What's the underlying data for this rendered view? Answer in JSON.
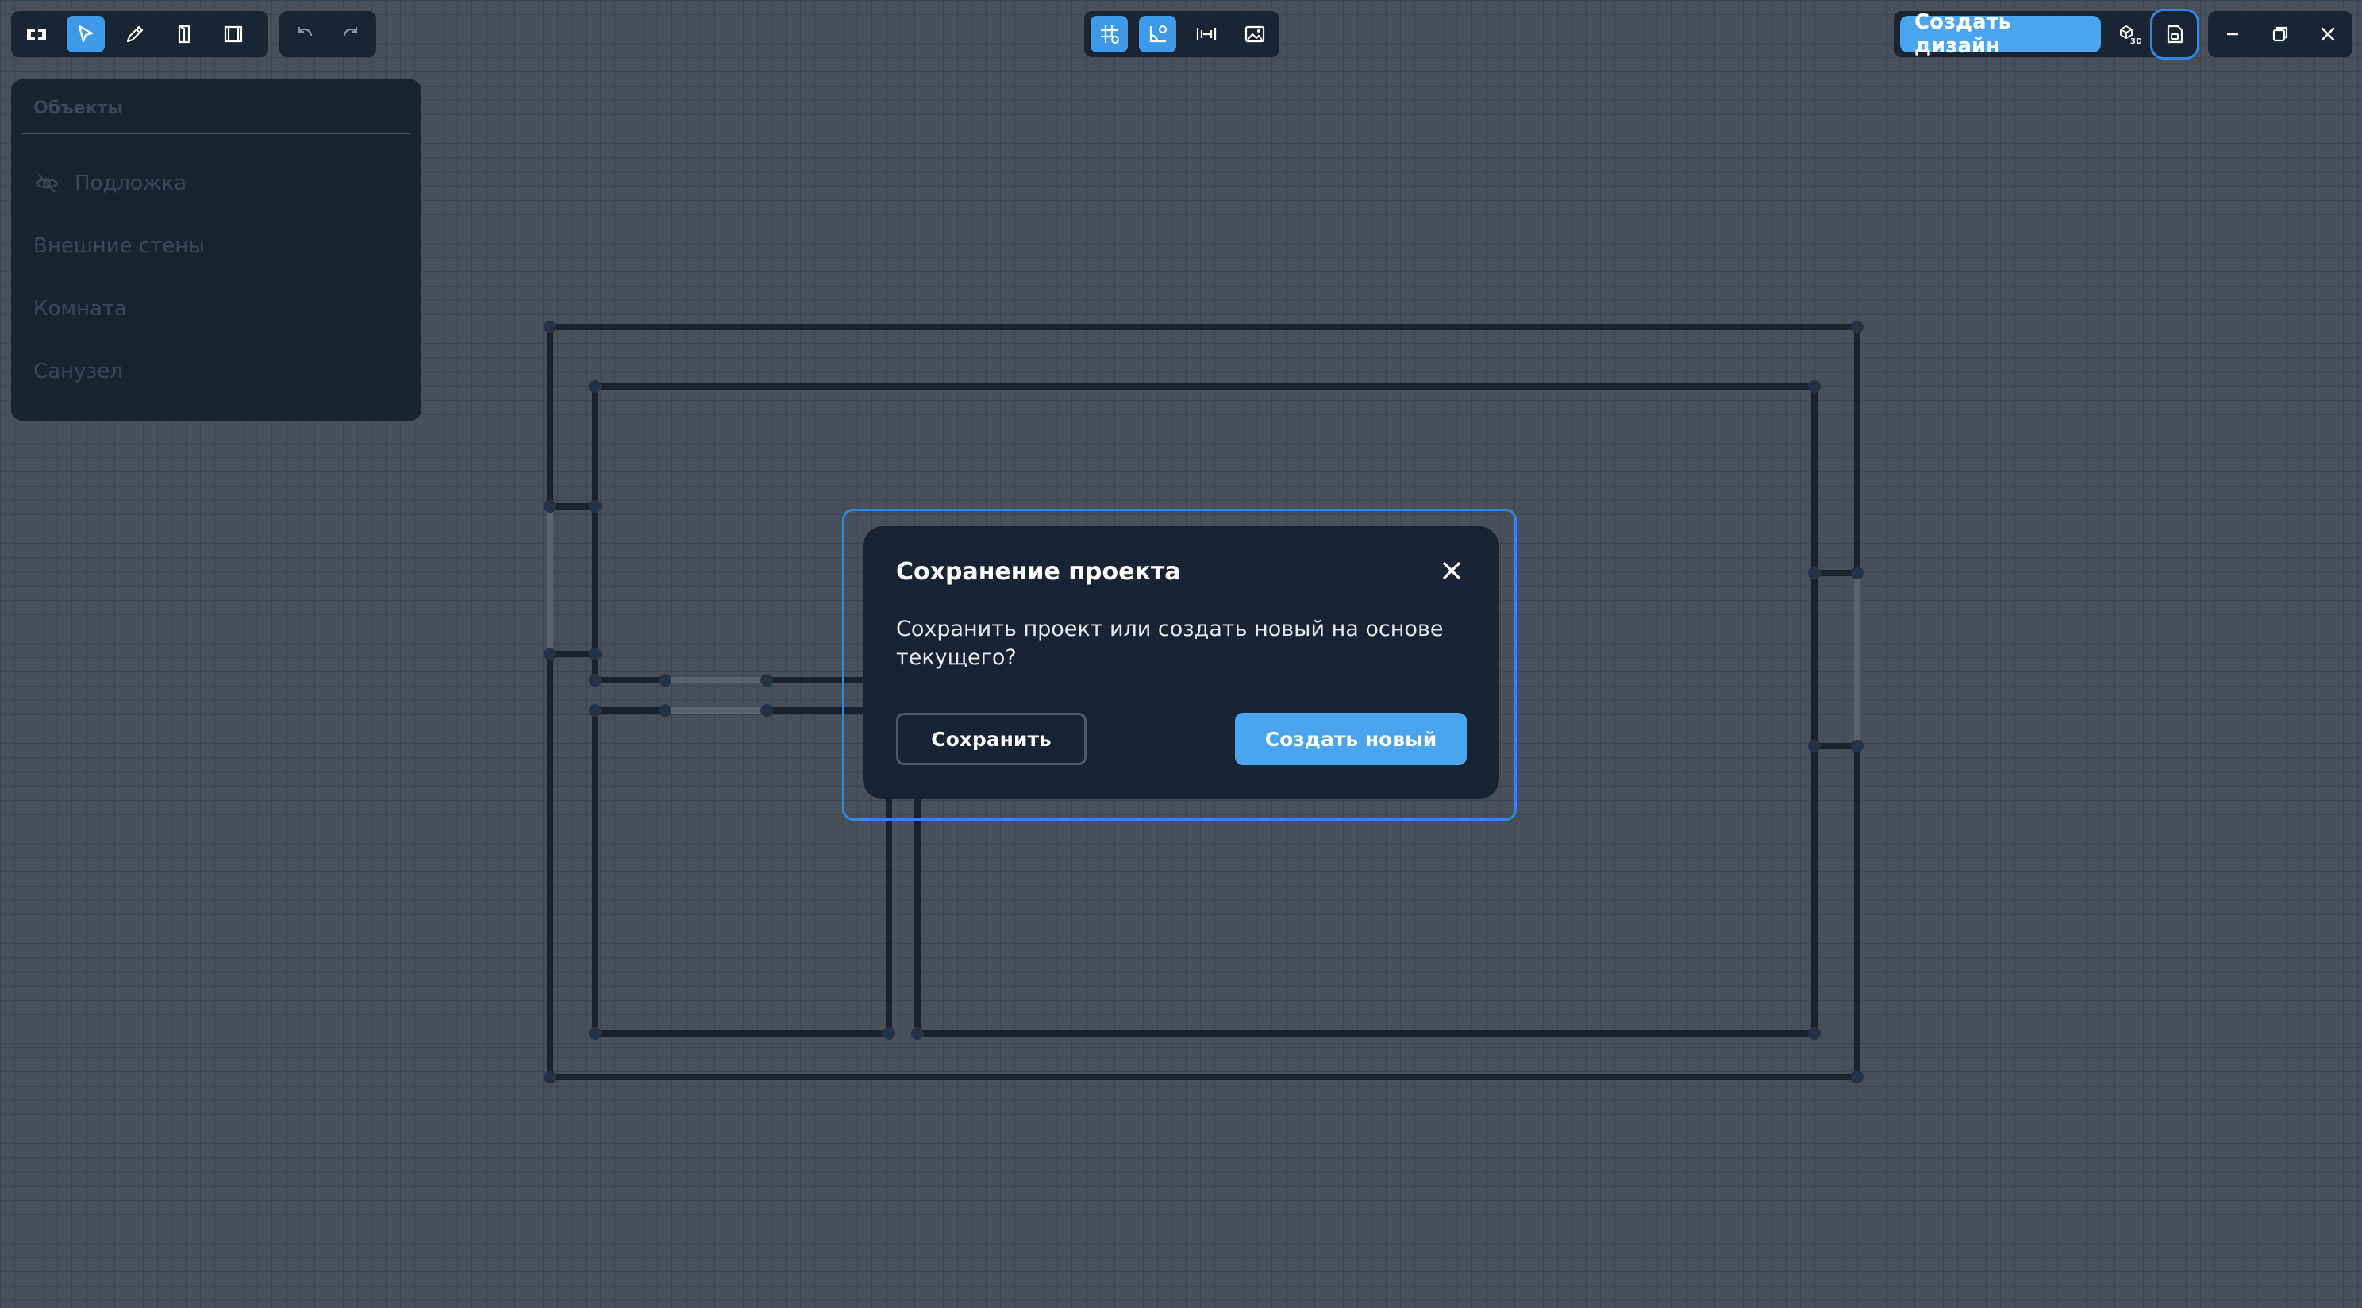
{
  "colors": {
    "canvas_bg": "#495059",
    "toolbar_bg": "#1a2533",
    "accent": "#4aa4f0",
    "active_tool": "#3d9ae8",
    "wall": "#1a222d",
    "dialog_bg": "#182433"
  },
  "toolbar_left": {
    "tools": [
      {
        "icon": "floorplan-icon",
        "active": false
      },
      {
        "icon": "pointer-icon",
        "active": true
      },
      {
        "icon": "pencil-icon",
        "active": false
      },
      {
        "icon": "door-icon",
        "active": false
      },
      {
        "icon": "window-icon",
        "active": false
      }
    ],
    "history": [
      {
        "icon": "undo-icon"
      },
      {
        "icon": "redo-icon"
      }
    ]
  },
  "toolbar_center": {
    "tools": [
      {
        "icon": "grid-snap-icon",
        "active": true
      },
      {
        "icon": "angle-snap-icon",
        "active": true
      },
      {
        "icon": "dimensions-icon",
        "active": false
      },
      {
        "icon": "image-icon",
        "active": false
      }
    ]
  },
  "toolbar_right": {
    "create_design_label": "Создать дизайн",
    "view_3d_icon": "3d-view-icon",
    "save_icon": "save-icon"
  },
  "window_controls": [
    "minimize-icon",
    "restore-icon",
    "close-icon"
  ],
  "objects_panel": {
    "title": "Объекты",
    "items": [
      {
        "label": "Подложка",
        "icon": "eye-off-icon"
      },
      {
        "label": "Внешние стены"
      },
      {
        "label": "Комната"
      },
      {
        "label": "Санузел"
      }
    ]
  },
  "dialog": {
    "title": "Сохранение проекта",
    "message": "Сохранить проект или создать новый на основе текущего?",
    "save_label": "Сохранить",
    "create_new_label": "Создать новый"
  }
}
